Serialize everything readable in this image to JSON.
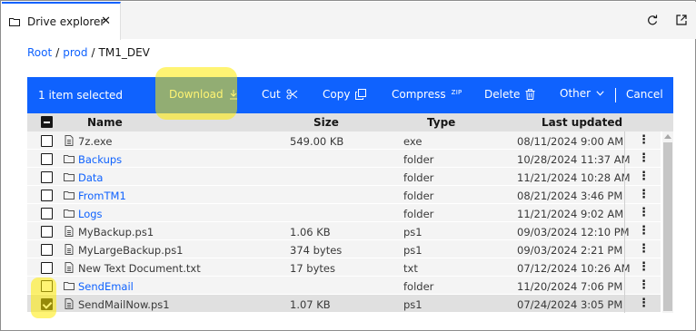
{
  "window": {
    "tab_label": "Drive explorer",
    "close_glyph": "✕",
    "icons": [
      "folder-icon",
      "refresh-icon",
      "launch-icon"
    ]
  },
  "breadcrumb": {
    "items": [
      "Root",
      "prod",
      "TM1_DEV"
    ],
    "separator": "/"
  },
  "actionbar": {
    "selected_text": "1 item selected",
    "download": "Download",
    "cut": "Cut",
    "copy": "Copy",
    "compress": "Compress",
    "compress_badge": "ZIP",
    "delete": "Delete",
    "other": "Other",
    "cancel": "Cancel",
    "color": "#0f62fe"
  },
  "table": {
    "headers": {
      "name": "Name",
      "size": "Size",
      "type": "Type",
      "updated": "Last updated"
    },
    "kebab_glyph": "⋮",
    "rows": [
      {
        "name": "7z.exe",
        "size": "549.00 KB",
        "type": "exe",
        "updated": "08/11/2024 9:00 AM",
        "kind": "file",
        "checked": false
      },
      {
        "name": "Backups",
        "size": "",
        "type": "folder",
        "updated": "10/28/2024 11:37 AM",
        "kind": "folder",
        "checked": false
      },
      {
        "name": "Data",
        "size": "",
        "type": "folder",
        "updated": "11/21/2024 10:28 AM",
        "kind": "folder",
        "checked": false
      },
      {
        "name": "FromTM1",
        "size": "",
        "type": "folder",
        "updated": "08/21/2024 3:46 PM",
        "kind": "folder",
        "checked": false
      },
      {
        "name": "Logs",
        "size": "",
        "type": "folder",
        "updated": "11/21/2024 9:02 AM",
        "kind": "folder",
        "checked": false
      },
      {
        "name": "MyBackup.ps1",
        "size": "1.06 KB",
        "type": "ps1",
        "updated": "09/03/2024 12:10 PM",
        "kind": "file",
        "checked": false
      },
      {
        "name": "MyLargeBackup.ps1",
        "size": "374 bytes",
        "type": "ps1",
        "updated": "09/03/2024 2:21 PM",
        "kind": "file",
        "checked": false
      },
      {
        "name": "New Text Document.txt",
        "size": "17 bytes",
        "type": "txt",
        "updated": "07/12/2024 10:26 AM",
        "kind": "file",
        "checked": false
      },
      {
        "name": "SendEmail",
        "size": "",
        "type": "folder",
        "updated": "11/20/2024 7:06 PM",
        "kind": "folder",
        "checked": false
      },
      {
        "name": "SendMailNow.ps1",
        "size": "1.07 KB",
        "type": "ps1",
        "updated": "07/24/2024 3:05 PM",
        "kind": "file",
        "checked": true
      }
    ]
  },
  "colors": {
    "link": "#0f62fe",
    "highlight": "#ffeb00"
  }
}
